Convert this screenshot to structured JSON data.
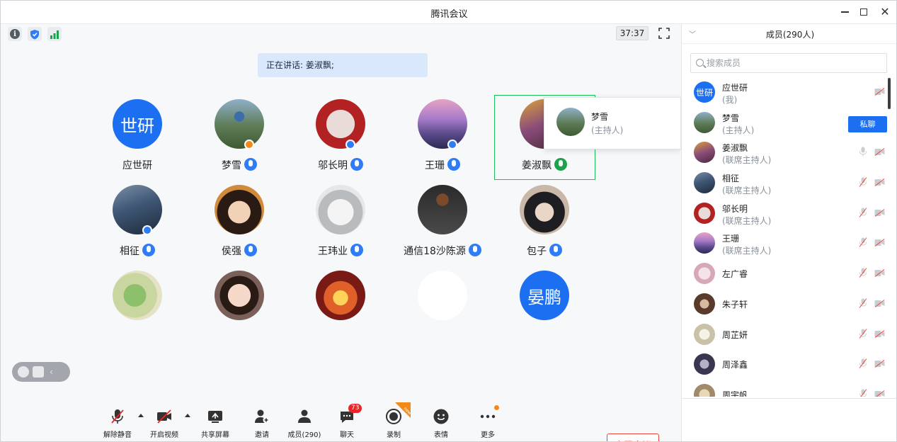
{
  "window": {
    "title": "腾讯会议"
  },
  "topbar": {
    "timer": "37:37"
  },
  "speaking": {
    "text": "正在讲话: 姜淑飘;"
  },
  "tiles": [
    {
      "name": "应世研",
      "avatar_text": "世研"
    },
    {
      "name": "梦雪"
    },
    {
      "name": "邬长明"
    },
    {
      "name": "王珊"
    },
    {
      "name": "姜淑飘"
    },
    {
      "name": "相征"
    },
    {
      "name": "侯强"
    },
    {
      "name": "王玮业"
    },
    {
      "name": "通信18沙陈源"
    },
    {
      "name": "包子"
    },
    {
      "name": ""
    },
    {
      "name": ""
    },
    {
      "name": ""
    },
    {
      "name": ""
    },
    {
      "name": "",
      "avatar_text": "晏鹏"
    }
  ],
  "hovercard": {
    "name": "梦雪",
    "role": "(主持人)"
  },
  "toolbar": {
    "unmute": "解除静音",
    "start_video": "开启视频",
    "share": "共享屏幕",
    "invite": "邀请",
    "members": "成员(290)",
    "chat": "聊天",
    "chat_badge": "73",
    "record": "录制",
    "record_tag": "new",
    "emoji": "表情",
    "more": "更多",
    "leave": "离开会议"
  },
  "panel": {
    "title": "成员(290人)",
    "search_placeholder": "搜索成员",
    "private_chat": "私聊",
    "members": [
      {
        "name": "应世研",
        "role": "(我)",
        "avatar_text": "世研"
      },
      {
        "name": "梦雪",
        "role": "(主持人)"
      },
      {
        "name": "姜淑飘",
        "role": "(联席主持人)"
      },
      {
        "name": "相征",
        "role": "(联席主持人)"
      },
      {
        "name": "邬长明",
        "role": "(联席主持人)"
      },
      {
        "name": "王珊",
        "role": "(联席主持人)"
      },
      {
        "name": "左广睿",
        "role": ""
      },
      {
        "name": "朱子轩",
        "role": ""
      },
      {
        "name": "周芷妍",
        "role": ""
      },
      {
        "name": "周泽鑫",
        "role": ""
      },
      {
        "name": "周宇帆",
        "role": ""
      }
    ]
  },
  "colors": {
    "accent": "#1d6ff2",
    "speaking_border": "#1bbf5a",
    "leave": "#e8453c",
    "badge": "#e8262a"
  }
}
